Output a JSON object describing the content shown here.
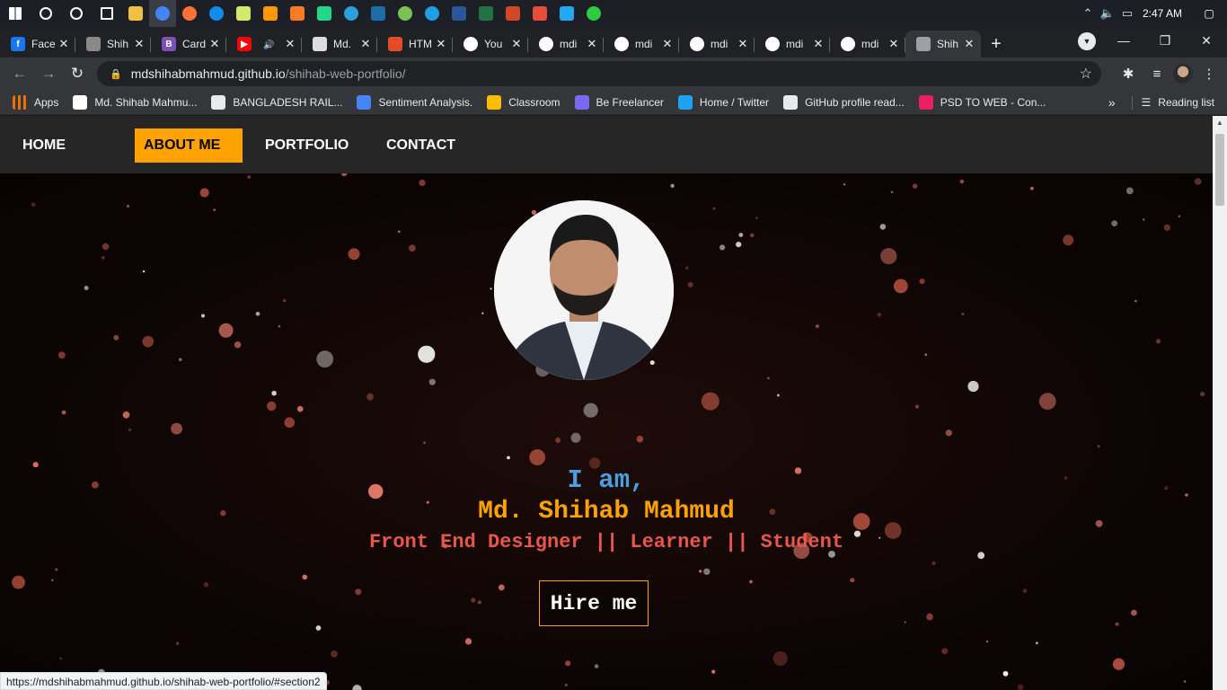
{
  "taskbar": {
    "icons": [
      {
        "name": "windows-start-icon",
        "color": "#ffffff"
      },
      {
        "name": "search-icon",
        "color": "#ffffff"
      },
      {
        "name": "cortana-icon",
        "color": "#ffffff"
      },
      {
        "name": "task-view-icon",
        "color": "#ffffff"
      },
      {
        "name": "file-explorer-icon",
        "color": "#f0c040"
      },
      {
        "name": "chrome-icon",
        "color": "#4285f4"
      },
      {
        "name": "firefox-icon",
        "color": "#ff7139"
      },
      {
        "name": "teamviewer-icon",
        "color": "#0e8ee9"
      },
      {
        "name": "notepad-icon",
        "color": "#d6e86a"
      },
      {
        "name": "sublime-icon",
        "color": "#ff9800"
      },
      {
        "name": "xampp-icon",
        "color": "#fb7a24"
      },
      {
        "name": "pycharm-icon",
        "color": "#21d789"
      },
      {
        "name": "telegram-icon",
        "color": "#2aa1da"
      },
      {
        "name": "app-icon",
        "color": "#1b6ea8"
      },
      {
        "name": "android-icon",
        "color": "#78c257"
      },
      {
        "name": "edge-icon",
        "color": "#1fa0e6"
      },
      {
        "name": "word-icon",
        "color": "#2b579a"
      },
      {
        "name": "excel-icon",
        "color": "#217346"
      },
      {
        "name": "powerpoint-icon",
        "color": "#d24726"
      },
      {
        "name": "app-grid-icon",
        "color": "#e84c3d"
      },
      {
        "name": "vscode-icon",
        "color": "#23a9f2"
      },
      {
        "name": "loader-icon",
        "color": "#2ecc40"
      }
    ],
    "clock": "2:47 AM"
  },
  "tabs": [
    {
      "title": "Face",
      "fav": "f",
      "color": "#1877f2"
    },
    {
      "title": "Shih",
      "fav": "",
      "color": "#888888"
    },
    {
      "title": "Card",
      "fav": "B",
      "color": "#7952b3"
    },
    {
      "title": "",
      "fav": "▶",
      "color": "#ff0000"
    },
    {
      "title": "Md.",
      "fav": "",
      "color": "#dddddd"
    },
    {
      "title": "HTM",
      "fav": "",
      "color": "#e34c26"
    },
    {
      "title": "You",
      "fav": "",
      "color": "#ffffff"
    },
    {
      "title": "mdi",
      "fav": "",
      "color": "#ffffff"
    },
    {
      "title": "mdi",
      "fav": "",
      "color": "#ffffff"
    },
    {
      "title": "mdi",
      "fav": "",
      "color": "#ffffff"
    },
    {
      "title": "mdi",
      "fav": "",
      "color": "#ffffff"
    },
    {
      "title": "mdi",
      "fav": "",
      "color": "#ffffff"
    },
    {
      "title": "Shih",
      "fav": "",
      "color": "#9aa0a6",
      "active": true
    }
  ],
  "address": {
    "host": "mdshihabmahmud.github.io",
    "path": "/shihab-web-portfolio/"
  },
  "bookmarks": [
    {
      "label": "Apps",
      "color": "#e8710a"
    },
    {
      "label": "Md. Shihab Mahmu...",
      "color": "#ffffff"
    },
    {
      "label": "BANGLADESH RAIL...",
      "color": "#e8eaed"
    },
    {
      "label": "Sentiment Analysis.",
      "color": "#4285f4"
    },
    {
      "label": "Classroom",
      "color": "#fbbc04"
    },
    {
      "label": "Be Freelancer",
      "color": "#7b68ee"
    },
    {
      "label": "Home / Twitter",
      "color": "#1da1f2"
    },
    {
      "label": "GitHub profile read...",
      "color": "#e8eaed"
    },
    {
      "label": "PSD TO WEB - Con...",
      "color": "#e91e63"
    }
  ],
  "reading_list": "Reading list",
  "site": {
    "nav": [
      "HOME",
      "ABOUT ME",
      "PORTFOLIO",
      "CONTACT"
    ],
    "active_nav": "ABOUT ME",
    "accent": "#ffa200",
    "iam": "I am,",
    "name": "Md. Shihab Mahmud",
    "role": "Front End Designer || Learner || Student",
    "hire": "Hire me"
  },
  "status_url": "https://mdshihabmahmud.github.io/shihab-web-portfolio/#section2"
}
